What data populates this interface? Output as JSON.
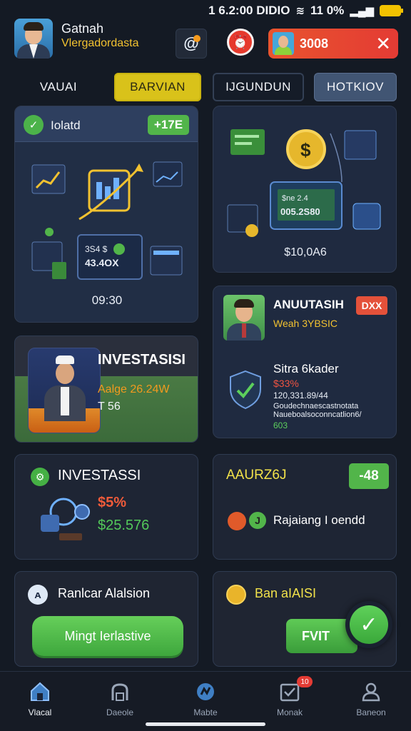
{
  "status_bar": {
    "time": "1 6.2:00 DIDIO",
    "percent": "11 0%"
  },
  "header": {
    "user_name": "Gatnah",
    "user_subtitle": "Vlergadordasta",
    "alert_text": "3008",
    "close_symbol": "✕"
  },
  "tabs": [
    {
      "label": "VAUAI"
    },
    {
      "label": "BARVIAN"
    },
    {
      "label": "IJGUNDUN"
    },
    {
      "label": "HOTKIOV"
    }
  ],
  "card_a": {
    "label": "Iolatd",
    "badge": "+17E",
    "value": "09:30",
    "screen_value_1": "3S4 $",
    "screen_value_2": "43.4OX"
  },
  "card_b": {
    "value": "$10,0A6",
    "screen_line_1": "$ne 2.4",
    "screen_line_2": "005.2S80"
  },
  "card_c": {
    "title": "INVESTASISI",
    "line1": "Aalge 26.24W",
    "line2": "T 56"
  },
  "card_d": {
    "title": "ANUUTASIH",
    "badge": "DXX",
    "subtitle": "Weah 3YBSIC",
    "line1": "Sitra 6kader",
    "line2": "$33%",
    "line3": "120,331.89/44",
    "line4": "Goudechnaescastnotata Naueboalsoconncatlion6/",
    "line5": "603"
  },
  "card_e": {
    "title": "INVESTASSI",
    "pct": "$5%",
    "amount": "$25.576"
  },
  "card_f": {
    "title": "AAURZ6J",
    "badge": "-48",
    "label": "Rajaiang I oendd"
  },
  "card_g": {
    "title": "Ranlcar Alalsion",
    "cta": "Mingt Ierlastive"
  },
  "card_h": {
    "title": "Ban aIAISI",
    "button": "FVIT"
  },
  "bottom_nav": [
    {
      "label": "Vlacal",
      "icon": "home-icon"
    },
    {
      "label": "Daeole",
      "icon": "portfolio-icon"
    },
    {
      "label": "Mabte",
      "icon": "market-icon"
    },
    {
      "label": "Monak",
      "icon": "inbox-icon",
      "badge": "10"
    },
    {
      "label": "Baneon",
      "icon": "profile-icon"
    }
  ],
  "colors": {
    "accent_yellow": "#d9c21a",
    "accent_green": "#52b54a",
    "accent_red": "#e43b34",
    "background": "#141a24"
  }
}
